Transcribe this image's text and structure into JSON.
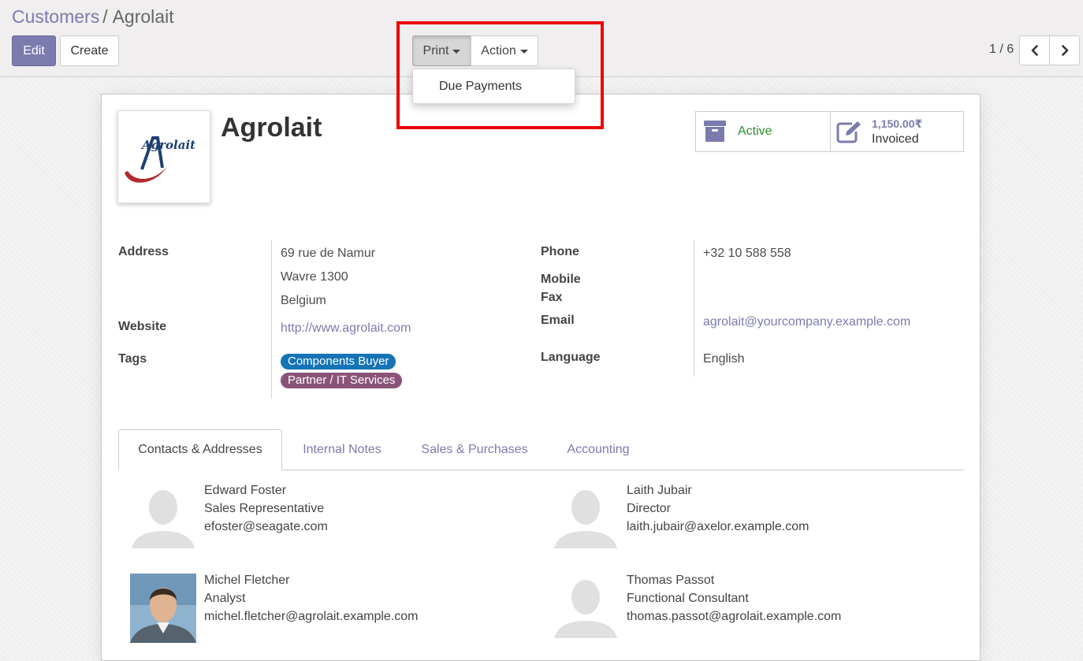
{
  "breadcrumb": {
    "parent": "Customers",
    "separator": "/",
    "current": "Agrolait"
  },
  "buttons": {
    "edit": "Edit",
    "create": "Create",
    "print": "Print",
    "action": "Action"
  },
  "print_menu": {
    "items": [
      "Due Payments"
    ]
  },
  "pager": {
    "value": "1 / 6"
  },
  "partner": {
    "name": "Agrolait",
    "logo_text": "Agrolait",
    "stat_active": "Active",
    "stat_invoiced_value": "1,150.00₹",
    "stat_invoiced_label": "Invoiced"
  },
  "fields": {
    "address_label": "Address",
    "address_lines": [
      "69 rue de Namur",
      "Wavre 1300",
      "Belgium"
    ],
    "website_label": "Website",
    "website": "http://www.agrolait.com",
    "tags_label": "Tags",
    "tags": [
      "Components Buyer",
      "Partner / IT Services"
    ],
    "phone_label": "Phone",
    "phone": "+32 10 588 558",
    "mobile_label": "Mobile",
    "fax_label": "Fax",
    "email_label": "Email",
    "email": "agrolait@yourcompany.example.com",
    "language_label": "Language",
    "language": "English"
  },
  "tabs": [
    "Contacts & Addresses",
    "Internal Notes",
    "Sales & Purchases",
    "Accounting"
  ],
  "contacts": [
    {
      "name": "Edward Foster",
      "function": "Sales Representative",
      "email": "efoster@seagate.com"
    },
    {
      "name": "Laith Jubair",
      "function": "Director",
      "email": "laith.jubair@axelor.example.com"
    },
    {
      "name": "Michel Fletcher",
      "function": "Analyst",
      "email": "michel.fletcher@agrolait.example.com"
    },
    {
      "name": "Thomas Passot",
      "function": "Functional Consultant",
      "email": "thomas.passot@agrolait.example.com"
    }
  ],
  "colors": {
    "brand": "#7c7bad",
    "active_text": "#2e8b2e",
    "tag_blue": "#1573b6",
    "tag_purple": "#8a5478",
    "highlight": "#ee0000"
  },
  "icons": {
    "archive": "archive-box-icon",
    "invoice": "pencil-square-icon",
    "prev": "chevron-left-icon",
    "next": "chevron-right-icon",
    "caret": "caret-down-icon"
  }
}
